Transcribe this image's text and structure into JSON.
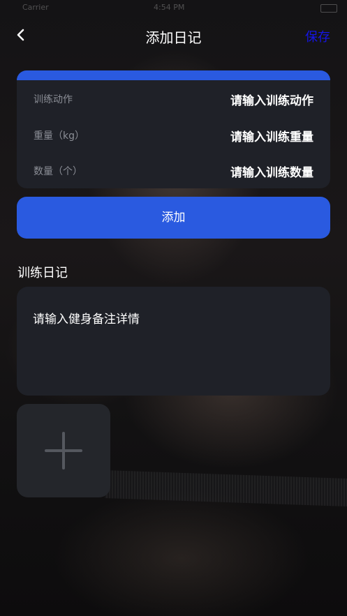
{
  "status_bar": {
    "carrier": "Carrier",
    "time": "4:54 PM"
  },
  "nav": {
    "title": "添加日记",
    "save_label": "保存",
    "back_icon": "chevron-left-icon"
  },
  "form": {
    "rows": [
      {
        "label": "训练动作",
        "placeholder": "请输入训练动作"
      },
      {
        "label": "重量（kg）",
        "placeholder": "请输入训练重量"
      },
      {
        "label": "数量（个）",
        "placeholder": "请输入训练数量"
      }
    ]
  },
  "add_button": {
    "label": "添加"
  },
  "diary": {
    "section_title": "训练日记",
    "placeholder": "请输入健身备注详情"
  },
  "photo_picker": {
    "icon": "plus-icon"
  },
  "colors": {
    "accent": "#2a5ae0",
    "save_text": "#1515e8",
    "card": "#1f2128"
  }
}
